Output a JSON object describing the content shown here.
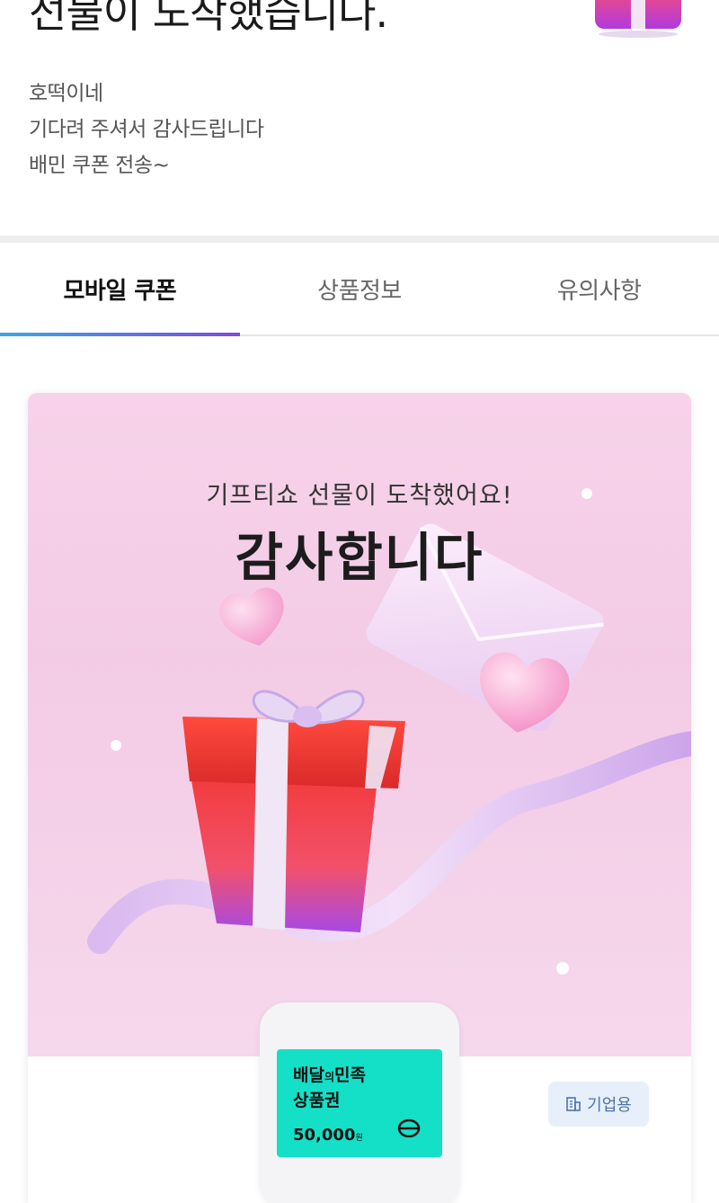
{
  "header": {
    "title": "선물이 도착했습니다.",
    "message_lines": [
      "호떡이네",
      "기다려 주셔서 감사드립니다",
      "배민 쿠폰 전송~"
    ]
  },
  "tabs": [
    {
      "label": "모바일 쿠폰",
      "active": true
    },
    {
      "label": "상품정보",
      "active": false
    },
    {
      "label": "유의사항",
      "active": false
    }
  ],
  "card": {
    "subtitle": "기프티쇼 선물이 도착했어요!",
    "headline": "감사합니다",
    "product": {
      "brand_main": "배달",
      "brand_mid": "의",
      "brand_end": "민족",
      "type": "상품권",
      "amount": "50,000",
      "currency": "원"
    },
    "badge": {
      "icon": "building-icon",
      "label": "기업용"
    }
  },
  "colors": {
    "tab_indicator_start": "#3aa7ea",
    "tab_indicator_end": "#7b4be0",
    "thumb_bg": "#14e0c8",
    "badge_bg": "#e6effa",
    "badge_text": "#5273a6"
  }
}
